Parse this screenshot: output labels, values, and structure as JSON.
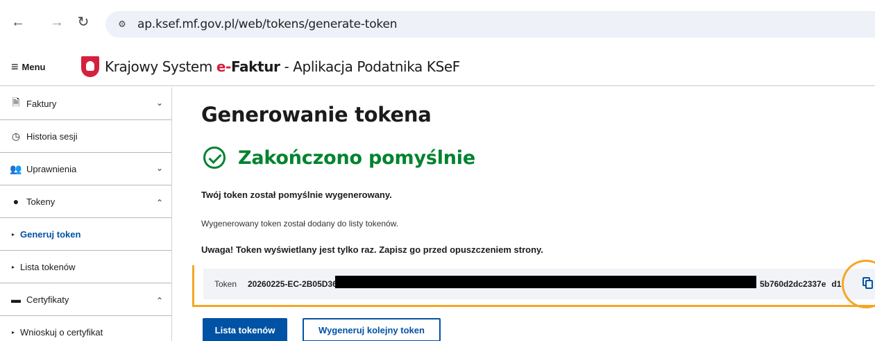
{
  "browser": {
    "back_icon": "arrow-left-icon",
    "forward_icon": "arrow-right-icon",
    "reload_icon": "reload-icon",
    "url": "ap.ksef.mf.gov.pl/web/tokens/generate-token"
  },
  "header": {
    "menu_label": "Menu",
    "title_prefix": "Krajowy System ",
    "title_e": "e-",
    "title_faktur": "Faktur",
    "title_suffix": " - Aplikacja Podatnika KSeF"
  },
  "sidebar": {
    "items": [
      {
        "label": "Faktury",
        "icon": "document-icon",
        "chevron": "down"
      },
      {
        "label": "Historia sesji",
        "icon": "clock-icon"
      },
      {
        "label": "Uprawnienia",
        "icon": "users-icon",
        "chevron": "down"
      },
      {
        "label": "Tokeny",
        "icon": "token-icon",
        "chevron": "up"
      },
      {
        "label": "Generuj token",
        "sub": true,
        "active": true
      },
      {
        "label": "Lista tokenów",
        "sub": true
      },
      {
        "label": "Certyfikaty",
        "icon": "certificate-icon",
        "chevron": "up"
      },
      {
        "label": "Wnioskuj o certyfikat",
        "sub": true
      }
    ]
  },
  "main": {
    "title": "Generowanie tokena",
    "success_text": "Zakończono pomyślnie",
    "msg_bold": "Twój token został pomyślnie wygenerowany.",
    "msg_normal": "Wygenerowany token został dodany do listy tokenów.",
    "msg_warning": "Uwaga! Token wyświetlany jest tylko raz. Zapisz go przed opuszczeniem strony.",
    "token_label": "Token",
    "token_start": "20260225-EC-2B05D3600",
    "token_end": "5b760d2dc2337e",
    "token_end2": "d1",
    "copy_icon": "copy-icon",
    "btn_list": "Lista tokenów",
    "btn_generate": "Wygeneruj kolejny token"
  },
  "colors": {
    "accent": "#0052a5",
    "success": "#00832f",
    "highlight": "#f5a623",
    "brand_red": "#d4213d"
  }
}
